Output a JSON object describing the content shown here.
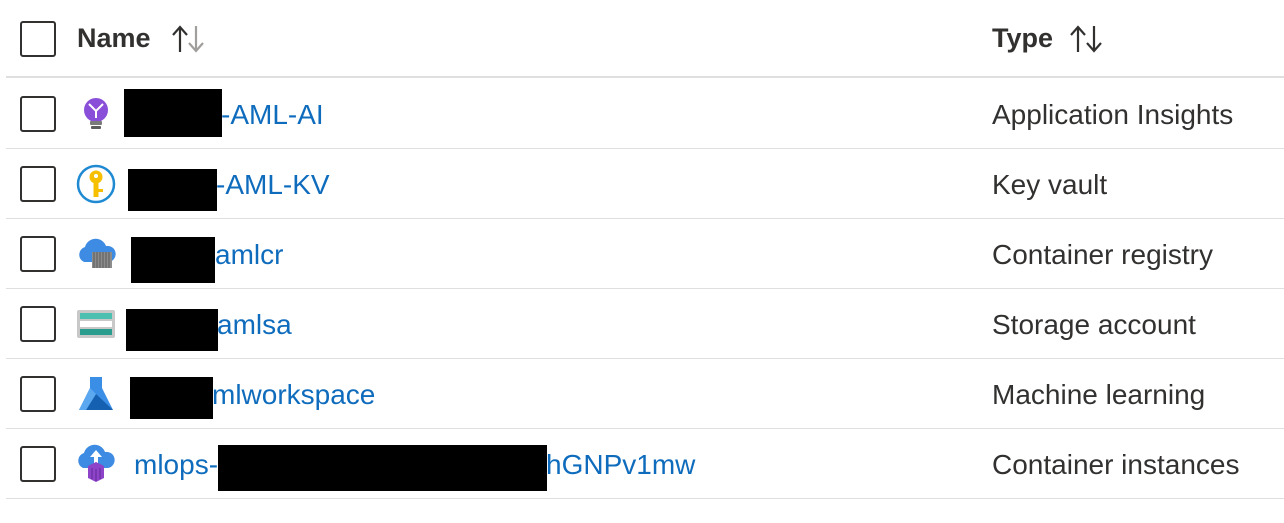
{
  "header": {
    "name_label": "Name",
    "type_label": "Type",
    "sort_icon": "sort-arrows-icon"
  },
  "rows": [
    {
      "name_prefix": "",
      "name_suffix": "-AML-AI",
      "type": "Application Insights",
      "icon": "application-insights-icon"
    },
    {
      "name_prefix": "",
      "name_suffix": "-AML-KV",
      "type": "Key vault",
      "icon": "key-vault-icon"
    },
    {
      "name_prefix": "",
      "name_suffix": "amlcr",
      "type": "Container registry",
      "icon": "container-registry-icon"
    },
    {
      "name_prefix": "",
      "name_suffix": "amlsa",
      "type": "Storage account",
      "icon": "storage-account-icon"
    },
    {
      "name_prefix": "",
      "name_suffix": "mlworkspace",
      "type": "Machine learning",
      "icon": "machine-learning-icon"
    },
    {
      "name_prefix": "mlops-",
      "name_suffix": "hGNPv1mw",
      "type": "Container instances",
      "icon": "container-instances-icon"
    }
  ],
  "colors": {
    "link": "#0f6cbd",
    "text": "#323130",
    "divider": "#e1dfdd"
  }
}
